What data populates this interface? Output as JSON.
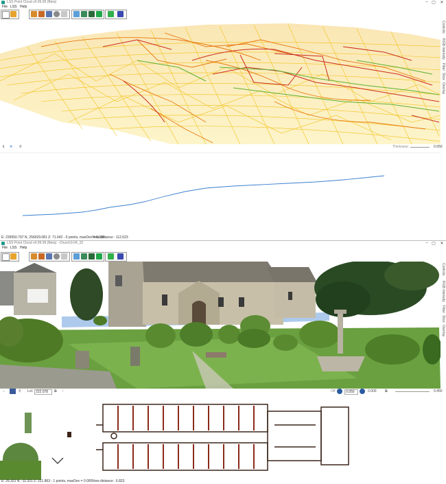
{
  "window1": {
    "title": "LSS Point Cloud v9.99.99 (Beta)",
    "menu": [
      "File",
      "LSS",
      "Help"
    ],
    "side_labels": [
      "Controls",
      "RGB Intensity",
      "Filter",
      "Slice",
      "Overlay"
    ],
    "status_left_icons": [
      "move-vertical-icon",
      "snowflake-icon",
      "pin-icon"
    ],
    "thickness_label": "Thickness:",
    "thickness_value": "0.050",
    "info_coords": "E: 239550.797 N,   256029.081 Z:   71.042 - 0 points, maxDev = 0.000",
    "info_view": "View distance : 112.623"
  },
  "window2": {
    "title": "LSS Point Cloud v9.99.99 (Beta) - Church3-04_15",
    "menu": [
      "File",
      "LSS",
      "Help"
    ],
    "side_labels": [
      "Controls",
      "RGB Intensity",
      "Filter",
      "Slice",
      "Overlay"
    ],
    "lod_label": "LoI:",
    "lod_value": "222.078",
    "off_label": "Off",
    "slice_value_a": "0.050",
    "slice_value_b": "0.000",
    "slice_value_c": "0.450",
    "info_coords": "E:      25.321 N,    -11.321 Z:   221.863 - 1 points, maxDev = 0.000",
    "info_view": "View distance : 6.823"
  },
  "colors": {
    "mesh_yellow": "#f2c21a",
    "mesh_orange": "#e8780e",
    "mesh_red": "#cc2a1c",
    "mesh_green": "#5ab02e",
    "profile_line": "#3a7fd0",
    "plan_wall": "#3a2418"
  }
}
